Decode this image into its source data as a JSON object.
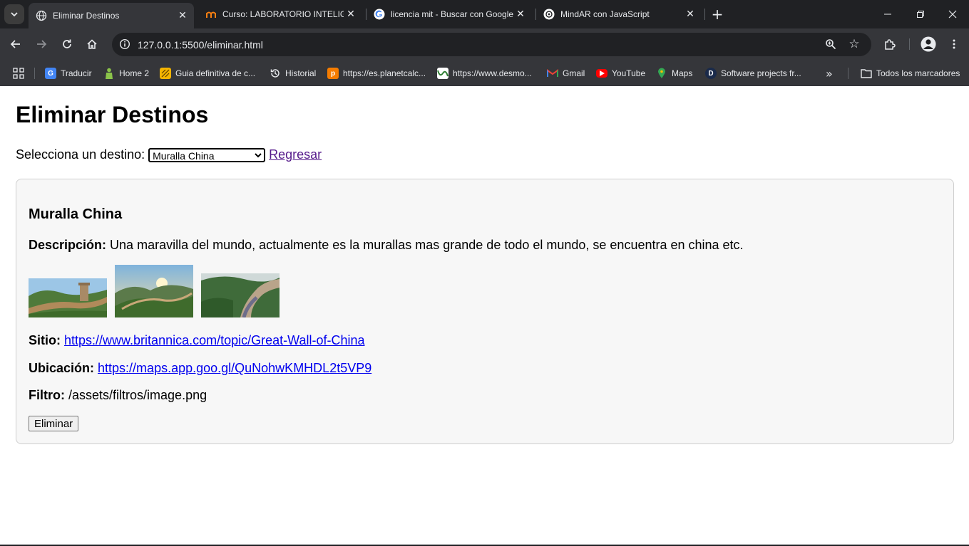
{
  "browser": {
    "tabs": [
      {
        "title": "Eliminar Destinos",
        "icon": "globe-icon",
        "active": true
      },
      {
        "title": "Curso: LABORATORIO INTELIGEN",
        "icon": "moodle-icon",
        "active": false
      },
      {
        "title": "licencia mit - Buscar con Google",
        "icon": "google-icon",
        "active": false
      },
      {
        "title": "MindAR con JavaScript",
        "icon": "openai-icon",
        "active": false
      }
    ],
    "url": "127.0.0.1:5500/eliminar.html",
    "bookmarks": [
      {
        "label": "Traducir",
        "icon": "translate-icon",
        "color": "#4285f4"
      },
      {
        "label": "Home 2",
        "icon": "person-icon",
        "color": "#8bc34a"
      },
      {
        "label": "Guia definitiva de c...",
        "icon": "guide-icon",
        "color": "#f4b400"
      },
      {
        "label": "Historial",
        "icon": "history-icon",
        "color": "#e8eaed"
      },
      {
        "label": "https://es.planetcalc...",
        "icon": "planetcalc-icon",
        "color": "#f57c00"
      },
      {
        "label": "https://www.desmo...",
        "icon": "desmos-icon",
        "color": "#2e7d32"
      },
      {
        "label": "Gmail",
        "icon": "gmail-icon",
        "color": "#ea4335"
      },
      {
        "label": "YouTube",
        "icon": "youtube-icon",
        "color": "#ff0000"
      },
      {
        "label": "Maps",
        "icon": "maps-icon",
        "color": "#34a853"
      },
      {
        "label": "Software projects fr...",
        "icon": "d-icon",
        "color": "#1a2a4a"
      }
    ],
    "bookmarks_folder": "Todos los marcadores"
  },
  "page": {
    "title": "Eliminar Destinos",
    "select_label": "Selecciona un destino:",
    "select_value": "Muralla China",
    "back_link": "Regresar",
    "card": {
      "name": "Muralla China",
      "desc_label": "Descripción:",
      "desc_value": "Una maravilla del mundo, actualmente es la murallas mas grande de todo el mundo, se encuentra en china etc.",
      "site_label": "Sitio:",
      "site_value": "https://www.britannica.com/topic/Great-Wall-of-China",
      "location_label": "Ubicación:",
      "location_value": "https://maps.app.goo.gl/QuNohwKMHDL2t5VP9",
      "filter_label": "Filtro:",
      "filter_value": "/assets/filtros/image.png",
      "delete_button": "Eliminar"
    }
  }
}
